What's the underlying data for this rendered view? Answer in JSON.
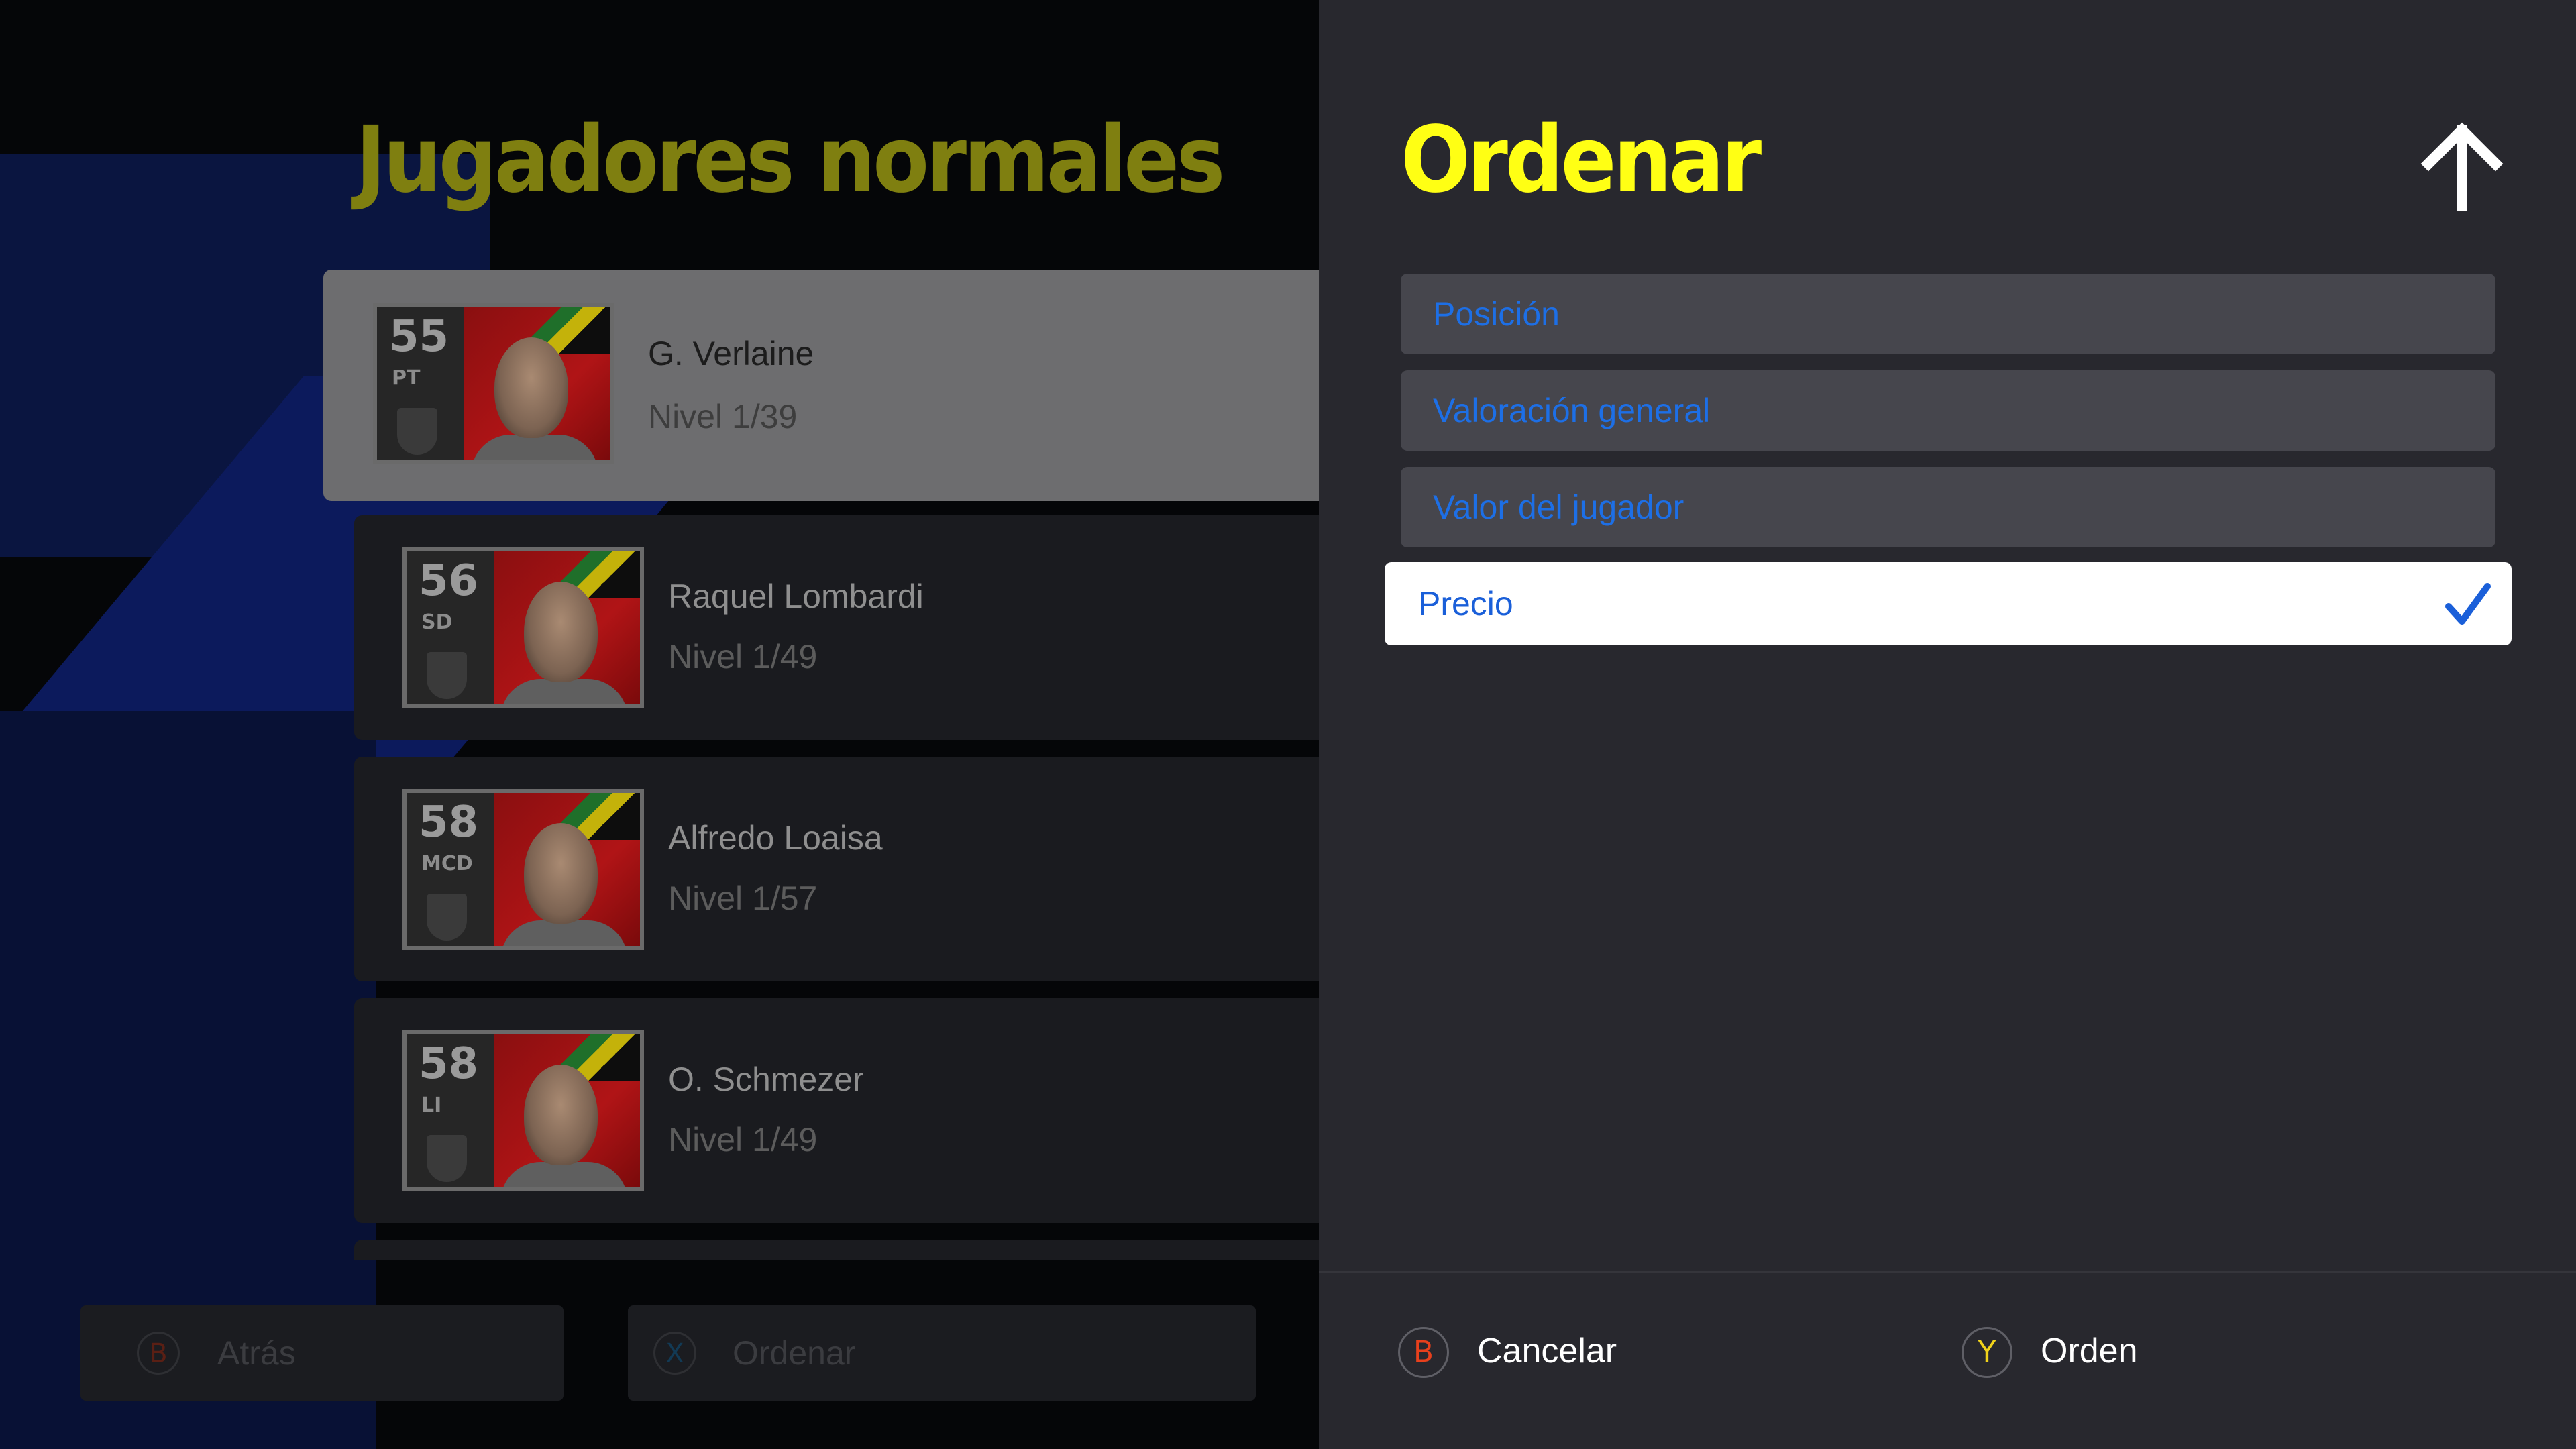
{
  "left_panel": {
    "title": "Jugadores normales",
    "players": [
      {
        "rating": "55",
        "position": "PT",
        "name": "G. Verlaine",
        "level": "Nivel 1/39",
        "selected": true
      },
      {
        "rating": "56",
        "position": "SD",
        "name": "Raquel Lombardi",
        "level": "Nivel 1/49",
        "selected": false
      },
      {
        "rating": "58",
        "position": "MCD",
        "name": "Alfredo Loaisa",
        "level": "Nivel 1/57",
        "selected": false
      },
      {
        "rating": "58",
        "position": "LI",
        "name": "O. Schmezer",
        "level": "Nivel 1/49",
        "selected": false
      }
    ],
    "footer": {
      "back_key": "B",
      "back_label": "Atrás",
      "sort_key": "X",
      "sort_label": "Ordenar"
    }
  },
  "sort_menu": {
    "title": "Ordenar",
    "direction_icon": "arrow-up-icon",
    "options": [
      {
        "label": "Posición",
        "selected": false
      },
      {
        "label": "Valoración general",
        "selected": false
      },
      {
        "label": "Valor del jugador",
        "selected": false
      },
      {
        "label": "Precio",
        "selected": true
      }
    ],
    "footer": {
      "cancel_key": "B",
      "cancel_label": "Cancelar",
      "order_key": "Y",
      "order_label": "Orden"
    }
  },
  "colors": {
    "accent_yellow": "#ffff14",
    "option_blue": "#1d6fe6",
    "key_b": "#e8401c",
    "key_y": "#f0d21a",
    "key_x": "#1e8fd6"
  }
}
